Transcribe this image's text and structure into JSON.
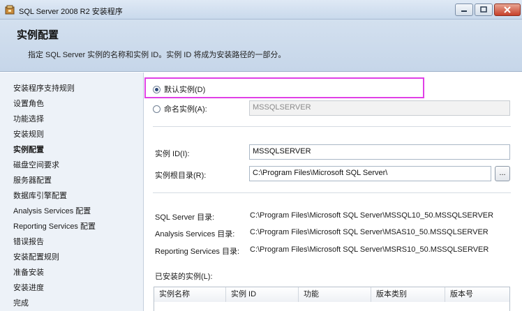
{
  "window": {
    "title": "SQL Server 2008 R2 安装程序",
    "controls": {
      "minimize_icon": "minimize-icon",
      "maximize_icon": "maximize-icon",
      "close_icon": "close-icon"
    }
  },
  "header": {
    "title": "实例配置",
    "description": "指定 SQL Server 实例的名称和实例 ID。实例 ID 将成为安装路径的一部分。"
  },
  "sidebar": {
    "items": [
      {
        "label": "安装程序支持规则"
      },
      {
        "label": "设置角色"
      },
      {
        "label": "功能选择"
      },
      {
        "label": "安装规则"
      },
      {
        "label": "实例配置",
        "active": true
      },
      {
        "label": "磁盘空间要求"
      },
      {
        "label": "服务器配置"
      },
      {
        "label": "数据库引擎配置"
      },
      {
        "label": "Analysis Services 配置"
      },
      {
        "label": "Reporting Services 配置"
      },
      {
        "label": "错误报告"
      },
      {
        "label": "安装配置规则"
      },
      {
        "label": "准备安装"
      },
      {
        "label": "安装进度"
      },
      {
        "label": "完成"
      }
    ]
  },
  "instance": {
    "default_label": "默认实例(D)",
    "named_label": "命名实例(A):",
    "named_value": "MSSQLSERVER",
    "selected": "default"
  },
  "fields": {
    "instance_id_label": "实例 ID(I):",
    "instance_id_value": "MSSQLSERVER",
    "root_dir_label": "实例根目录(R):",
    "root_dir_value": "C:\\Program Files\\Microsoft SQL Server\\",
    "browse_label": "..."
  },
  "directories": [
    {
      "label": "SQL Server 目录:",
      "value": "C:\\Program Files\\Microsoft SQL Server\\MSSQL10_50.MSSQLSERVER"
    },
    {
      "label": "Analysis Services 目录:",
      "value": "C:\\Program Files\\Microsoft SQL Server\\MSAS10_50.MSSQLSERVER"
    },
    {
      "label": "Reporting Services 目录:",
      "value": "C:\\Program Files\\Microsoft SQL Server\\MSRS10_50.MSSQLSERVER"
    }
  ],
  "installed": {
    "label": "已安装的实例(L):",
    "columns": [
      "实例名称",
      "实例 ID",
      "功能",
      "版本类别",
      "版本号"
    ]
  }
}
